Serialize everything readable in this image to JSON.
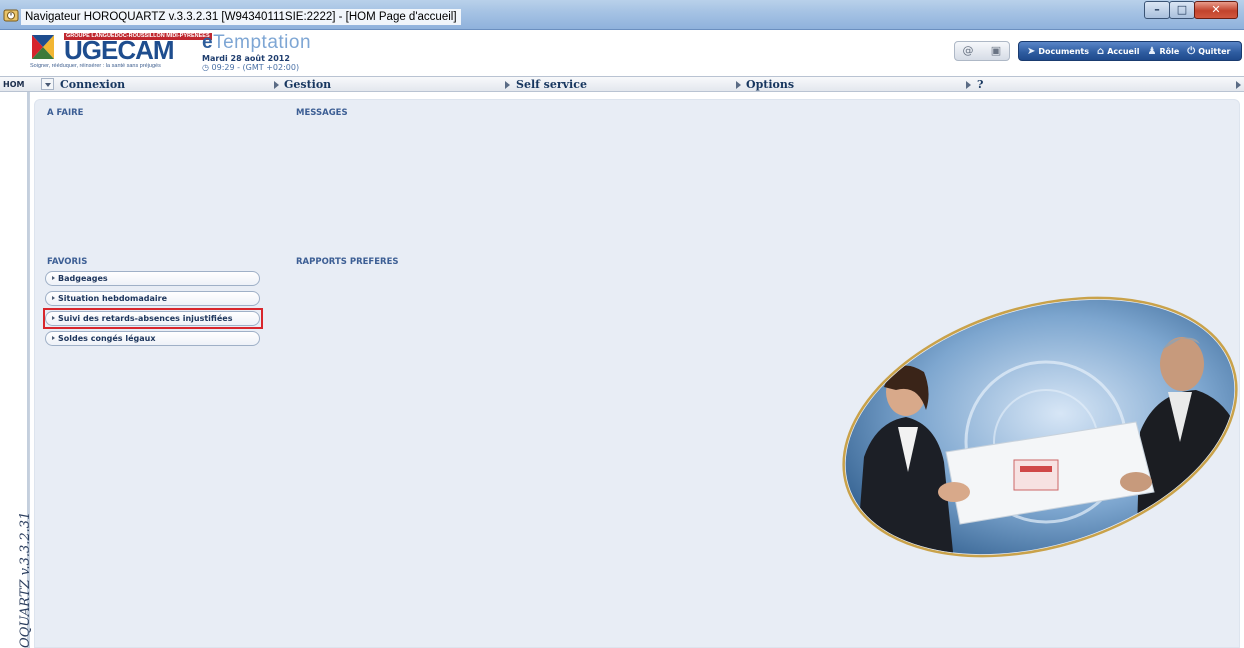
{
  "window": {
    "title": "Navigateur HOROQUARTZ v.3.3.2.31 [W94340111SIE:2222] - [HOM  Page d'accueil]",
    "buttons": [
      "minimize",
      "maximize",
      "close"
    ]
  },
  "header": {
    "logo_groupe": "GROUPE LANGUEDOC-ROUSSILLON MIDI-PYRÉNÉES",
    "logo_name": "UGECAM",
    "logo_slogan": "Soigner, rééduquer, réinsérer : la santé sans préjugés",
    "brand_e": "e",
    "brand_rest": "Temptation",
    "date": "Mardi 28 août 2012",
    "time": "09:29 - (GMT +02:00)",
    "nav": {
      "documents": "Documents",
      "accueil": "Accueil",
      "role": "Rôle",
      "quitter": "Quitter"
    }
  },
  "menubar": {
    "hom": "HOM",
    "items": [
      "Connexion",
      "Gestion",
      "Self service",
      "Options",
      "?"
    ]
  },
  "sidebar": {
    "vertical_text": "OQUARTZ v.3.3.2.31"
  },
  "main": {
    "a_faire": "A FAIRE",
    "messages": "MESSAGES",
    "favoris": "FAVORIS",
    "rapports": "RAPPORTS PREFERES",
    "favorites": [
      "Badgeages",
      "Situation hebdomadaire",
      "Suivi des retards-absences injustifiées",
      "Soldes congés légaux"
    ],
    "highlighted_favorite_index": 2
  },
  "colors": {
    "accent": "#2d5b9f",
    "panel": "#e8edf5",
    "highlight": "#d8262c"
  }
}
